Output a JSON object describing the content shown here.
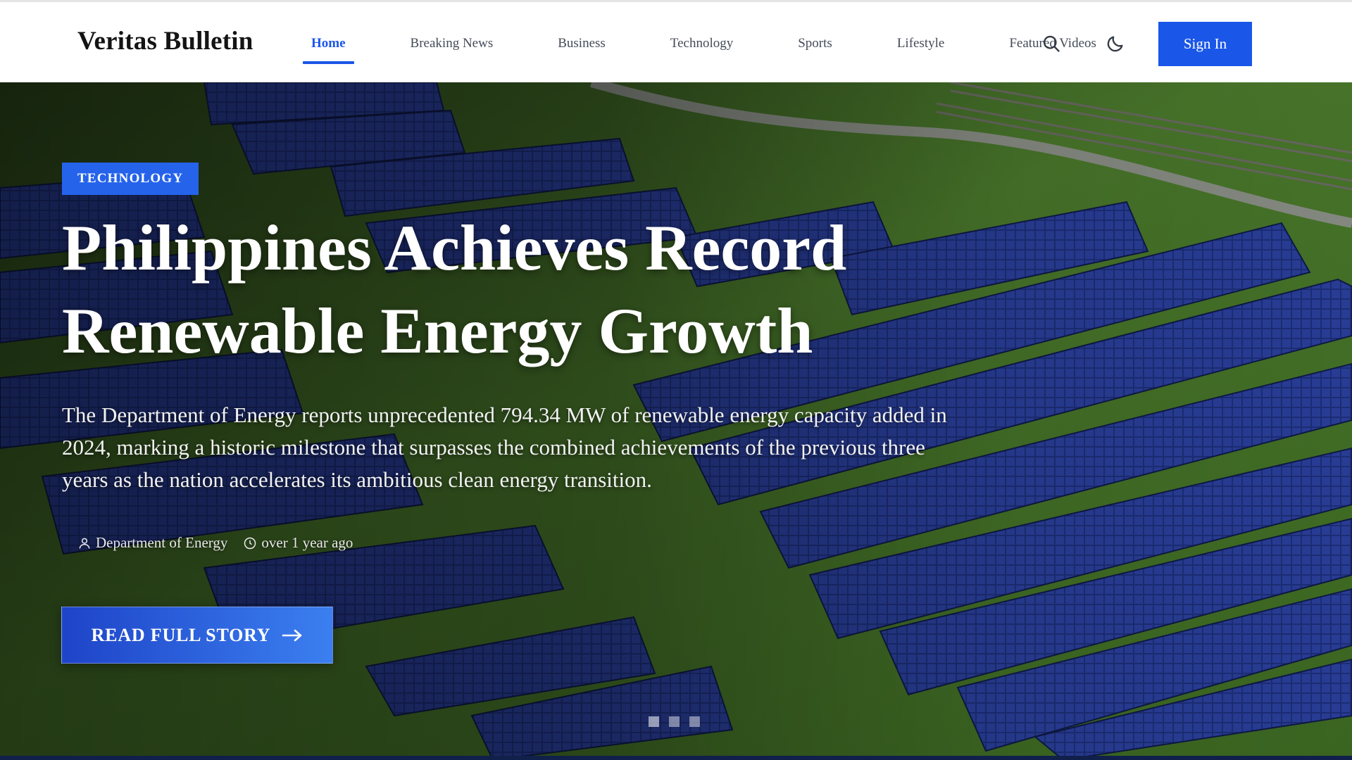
{
  "site": {
    "title": "Veritas Bulletin"
  },
  "nav": {
    "items": [
      {
        "label": "Home",
        "active": true
      },
      {
        "label": "Breaking News",
        "active": false
      },
      {
        "label": "Business",
        "active": false
      },
      {
        "label": "Technology",
        "active": false
      },
      {
        "label": "Sports",
        "active": false
      },
      {
        "label": "Lifestyle",
        "active": false
      },
      {
        "label": "Featured Videos",
        "active": false
      }
    ],
    "search_icon": "search-icon",
    "theme_icon": "moon-icon",
    "sign_in_label": "Sign In"
  },
  "hero": {
    "category": "TECHNOLOGY",
    "headline": "Philippines Achieves Record Renewable Energy Growth",
    "summary": "The Department of Energy reports unprecedented 794.34 MW of renewable energy capacity added in 2024, marking a historic milestone that surpasses the combined achievements of the previous three years as the nation accelerates its ambitious clean energy transition.",
    "author": "Department of Energy",
    "time": "over 1 year ago",
    "cta_label": "READ FULL STORY",
    "slide_count": 3,
    "active_slide": 1
  },
  "colors": {
    "accent": "#1a56e8",
    "badge": "#2563eb",
    "logo": "#141414",
    "nav_text": "#444c58"
  }
}
